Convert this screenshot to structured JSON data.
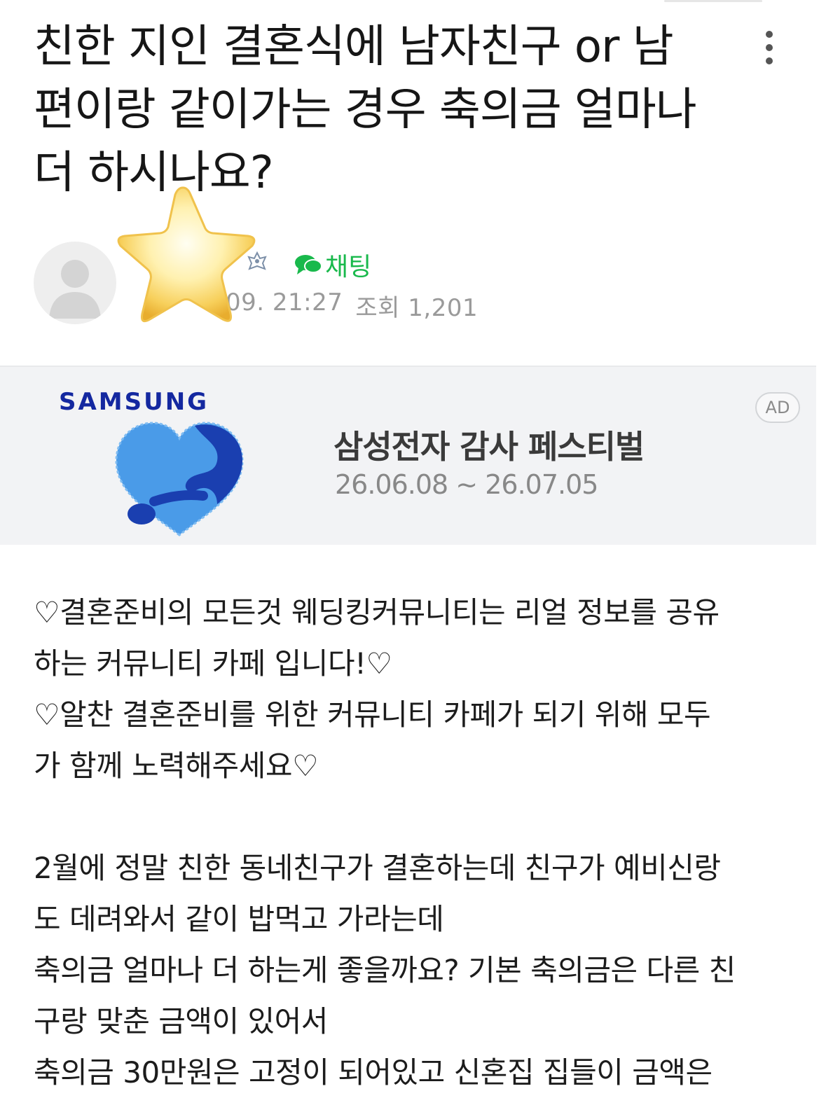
{
  "post": {
    "title_lines": [
      "친한 지인 결혼식에 남자친구 or 남",
      "편이랑 같이가는 경우 축의금 얼마나",
      "더 하시나요?"
    ]
  },
  "author": {
    "chat_label": "채팅",
    "datetime_visible": "09. 21:27",
    "views_label": "조회",
    "views_count": "1,201"
  },
  "ad": {
    "brand": "SAMSUNG",
    "title": "삼성전자 감사 페스티벌",
    "period": "26.06.08 ~ 26.07.05",
    "badge": "AD",
    "colors": {
      "brand": "#1428a0",
      "heart_light": "#4a9be8",
      "heart_dark": "#1a3fb0"
    }
  },
  "content": {
    "lines": [
      "♡결혼준비의 모든것 웨딩킹커뮤니티는 리얼 정보를 공유",
      "하는 커뮤니티 카페 입니다!♡",
      "♡알찬 결혼준비를 위한 커뮤니티 카페가 되기 위해 모두",
      "가 함께 노력해주세요♡",
      "",
      "2월에 정말 친한 동네친구가 결혼하는데 친구가 예비신랑",
      "도 데려와서 같이 밥먹고 가라는데",
      "축의금 얼마나 더 하는게 좋을까요? 기본 축의금은 다른 친",
      "구랑 맞춘 금액이 있어서",
      "축의금 30만원은 고정이 되어있고 신혼집 집들이 금액은"
    ]
  },
  "colors": {
    "chat_green": "#19b94c",
    "meta_gray": "#9a9a9a"
  }
}
